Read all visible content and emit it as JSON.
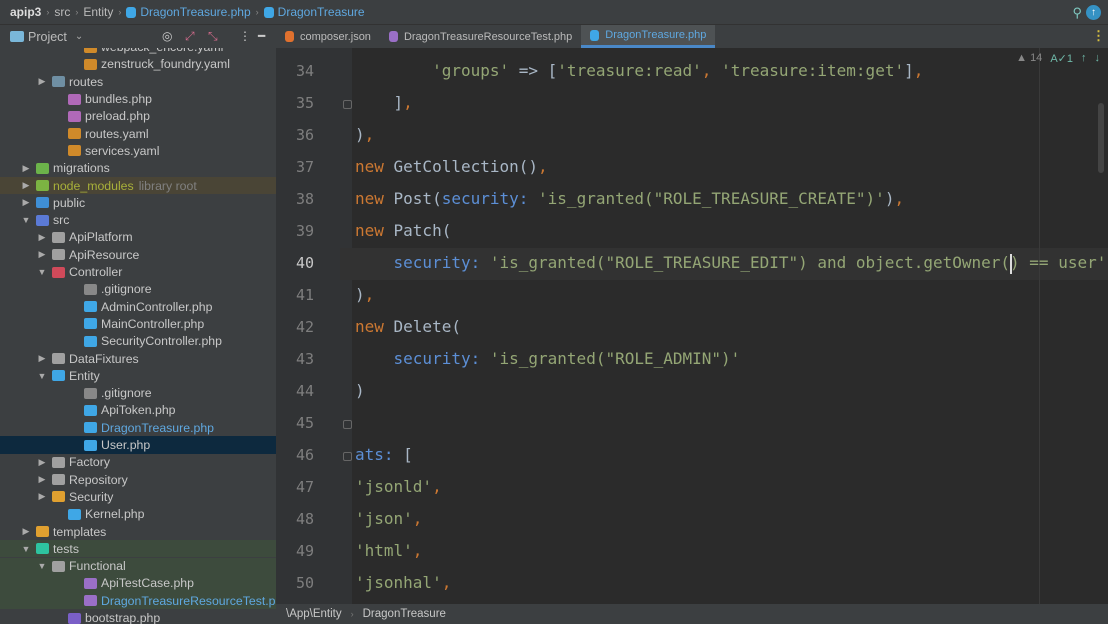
{
  "breadcrumb": [
    "apip3",
    "src",
    "Entity",
    "DragonTreasure.php",
    "DragonTreasure"
  ],
  "project_panel": {
    "label": "Project"
  },
  "tabs": [
    {
      "label": "composer.json",
      "color": "#e0712e",
      "active": false
    },
    {
      "label": "DragonTreasureResourceTest.php",
      "color": "#9a6fc7",
      "active": false
    },
    {
      "label": "DragonTreasure.php",
      "color": "#3fa7e6",
      "active": true
    }
  ],
  "tree": [
    {
      "label": "webpack_encore.yaml",
      "level": 4,
      "icon": "#d08a2a"
    },
    {
      "label": "zenstruck_foundry.yaml",
      "level": 4,
      "icon": "#d08a2a"
    },
    {
      "label": "routes",
      "level": 2,
      "icon": "#6f8fa3",
      "arrow": "›"
    },
    {
      "label": "bundles.php",
      "level": 3,
      "icon": "#b069b8"
    },
    {
      "label": "preload.php",
      "level": 3,
      "icon": "#b069b8"
    },
    {
      "label": "routes.yaml",
      "level": 3,
      "icon": "#d08a2a"
    },
    {
      "label": "services.yaml",
      "level": 3,
      "icon": "#d08a2a"
    },
    {
      "label": "migrations",
      "level": 1,
      "icon": "#6cb34a",
      "arrow": "›"
    },
    {
      "label": "node_modules",
      "suffix": "library root",
      "level": 1,
      "icon": "#7cb342",
      "arrow": "›",
      "state": "hl"
    },
    {
      "label": "public",
      "level": 1,
      "icon": "#3f8fd6",
      "arrow": "›"
    },
    {
      "label": "src",
      "level": 1,
      "icon": "#5b7ad6",
      "arrow": "⌄"
    },
    {
      "label": "ApiPlatform",
      "level": 2,
      "icon": "#a0a0a0",
      "arrow": "›"
    },
    {
      "label": "ApiResource",
      "level": 2,
      "icon": "#a0a0a0",
      "arrow": "›"
    },
    {
      "label": "Controller",
      "level": 2,
      "icon": "#d04a5a",
      "arrow": "⌄"
    },
    {
      "label": ".gitignore",
      "level": 4,
      "icon": "#888888"
    },
    {
      "label": "AdminController.php",
      "level": 4,
      "icon": "#3fa7e6"
    },
    {
      "label": "MainController.php",
      "level": 4,
      "icon": "#3fa7e6"
    },
    {
      "label": "SecurityController.php",
      "level": 4,
      "icon": "#3fa7e6"
    },
    {
      "label": "DataFixtures",
      "level": 2,
      "icon": "#a0a0a0",
      "arrow": "›"
    },
    {
      "label": "Entity",
      "level": 2,
      "icon": "#3fa7e6",
      "arrow": "⌄"
    },
    {
      "label": ".gitignore",
      "level": 4,
      "icon": "#888888"
    },
    {
      "label": "ApiToken.php",
      "level": 4,
      "icon": "#3fa7e6"
    },
    {
      "label": "DragonTreasure.php",
      "level": 4,
      "icon": "#3fa7e6",
      "color": "#5fa8e0"
    },
    {
      "label": "User.php",
      "level": 4,
      "icon": "#3fa7e6",
      "state": "sel"
    },
    {
      "label": "Factory",
      "level": 2,
      "icon": "#a0a0a0",
      "arrow": "›"
    },
    {
      "label": "Repository",
      "level": 2,
      "icon": "#a0a0a0",
      "arrow": "›"
    },
    {
      "label": "Security",
      "level": 2,
      "icon": "#e0a030",
      "arrow": "›"
    },
    {
      "label": "Kernel.php",
      "level": 3,
      "icon": "#3fa7e6"
    },
    {
      "label": "templates",
      "level": 1,
      "icon": "#e0a030",
      "arrow": "›"
    },
    {
      "label": "tests",
      "level": 1,
      "icon": "#2ec4a0",
      "arrow": "⌄",
      "state": "test"
    },
    {
      "label": "Functional",
      "level": 2,
      "icon": "#a0a0a0",
      "arrow": "⌄",
      "state": "test"
    },
    {
      "label": "ApiTestCase.php",
      "level": 4,
      "icon": "#9a6fc7",
      "state": "test"
    },
    {
      "label": "DragonTreasureResourceTest.php",
      "level": 4,
      "icon": "#9a6fc7",
      "color": "#5fa8e0",
      "state": "test"
    },
    {
      "label": "bootstrap.php",
      "level": 3,
      "icon": "#7a5fc7"
    }
  ],
  "editor": {
    "inspections": {
      "warnings": "14",
      "typos": "1"
    },
    "current_line": "40",
    "lines": [
      {
        "num": "34",
        "tokens": [
          [
            "        ",
            "d"
          ],
          [
            "'groups'",
            "s"
          ],
          [
            " => [",
            "d"
          ],
          [
            "'treasure:read'",
            "s"
          ],
          [
            ", ",
            "p"
          ],
          [
            "'treasure:item:get'",
            "s"
          ],
          [
            "]",
            "d"
          ],
          [
            ",",
            "p"
          ]
        ]
      },
      {
        "num": "35",
        "tokens": [
          [
            "    ]",
            "d"
          ],
          [
            ",",
            "p"
          ]
        ]
      },
      {
        "num": "36",
        "tokens": [
          [
            ")",
            "d"
          ],
          [
            ",",
            "p"
          ]
        ]
      },
      {
        "num": "37",
        "tokens": [
          [
            "new ",
            "k"
          ],
          [
            "GetCollection()",
            "d"
          ],
          [
            ",",
            "p"
          ]
        ]
      },
      {
        "num": "38",
        "tokens": [
          [
            "new ",
            "k"
          ],
          [
            "Post(",
            "d"
          ],
          [
            "security: ",
            "n"
          ],
          [
            "'is_granted(\"ROLE_TREASURE_CREATE\")'",
            "s"
          ],
          [
            ")",
            "d"
          ],
          [
            ",",
            "p"
          ]
        ]
      },
      {
        "num": "39",
        "tokens": [
          [
            "new ",
            "k"
          ],
          [
            "Patch(",
            "d"
          ]
        ]
      },
      {
        "num": "40",
        "tokens": [
          [
            "    ",
            "d"
          ],
          [
            "security: ",
            "n"
          ],
          [
            "'is_granted(\"ROLE_TREASURE_EDIT\") and object.getOwner() == user'",
            "s"
          ]
        ]
      },
      {
        "num": "41",
        "tokens": [
          [
            ")",
            "d"
          ],
          [
            ",",
            "p"
          ]
        ]
      },
      {
        "num": "42",
        "tokens": [
          [
            "new ",
            "k"
          ],
          [
            "Delete(",
            "d"
          ]
        ]
      },
      {
        "num": "43",
        "tokens": [
          [
            "    ",
            "d"
          ],
          [
            "security: ",
            "n"
          ],
          [
            "'is_granted(\"ROLE_ADMIN\")'",
            "s"
          ]
        ]
      },
      {
        "num": "44",
        "tokens": [
          [
            ")",
            "d"
          ]
        ]
      },
      {
        "num": "45",
        "tokens": []
      },
      {
        "num": "46",
        "tokens": [
          [
            "ats: ",
            "n"
          ],
          [
            "[",
            "d"
          ]
        ]
      },
      {
        "num": "47",
        "tokens": [
          [
            "'jsonld'",
            "s"
          ],
          [
            ",",
            "p"
          ]
        ]
      },
      {
        "num": "48",
        "tokens": [
          [
            "'json'",
            "s"
          ],
          [
            ",",
            "p"
          ]
        ]
      },
      {
        "num": "49",
        "tokens": [
          [
            "'html'",
            "s"
          ],
          [
            ",",
            "p"
          ]
        ]
      },
      {
        "num": "50",
        "tokens": [
          [
            "'jsonhal'",
            "s"
          ],
          [
            ",",
            "p"
          ]
        ]
      }
    ]
  },
  "statusbar": {
    "namespace": "\\App\\Entity",
    "class": "DragonTreasure"
  }
}
